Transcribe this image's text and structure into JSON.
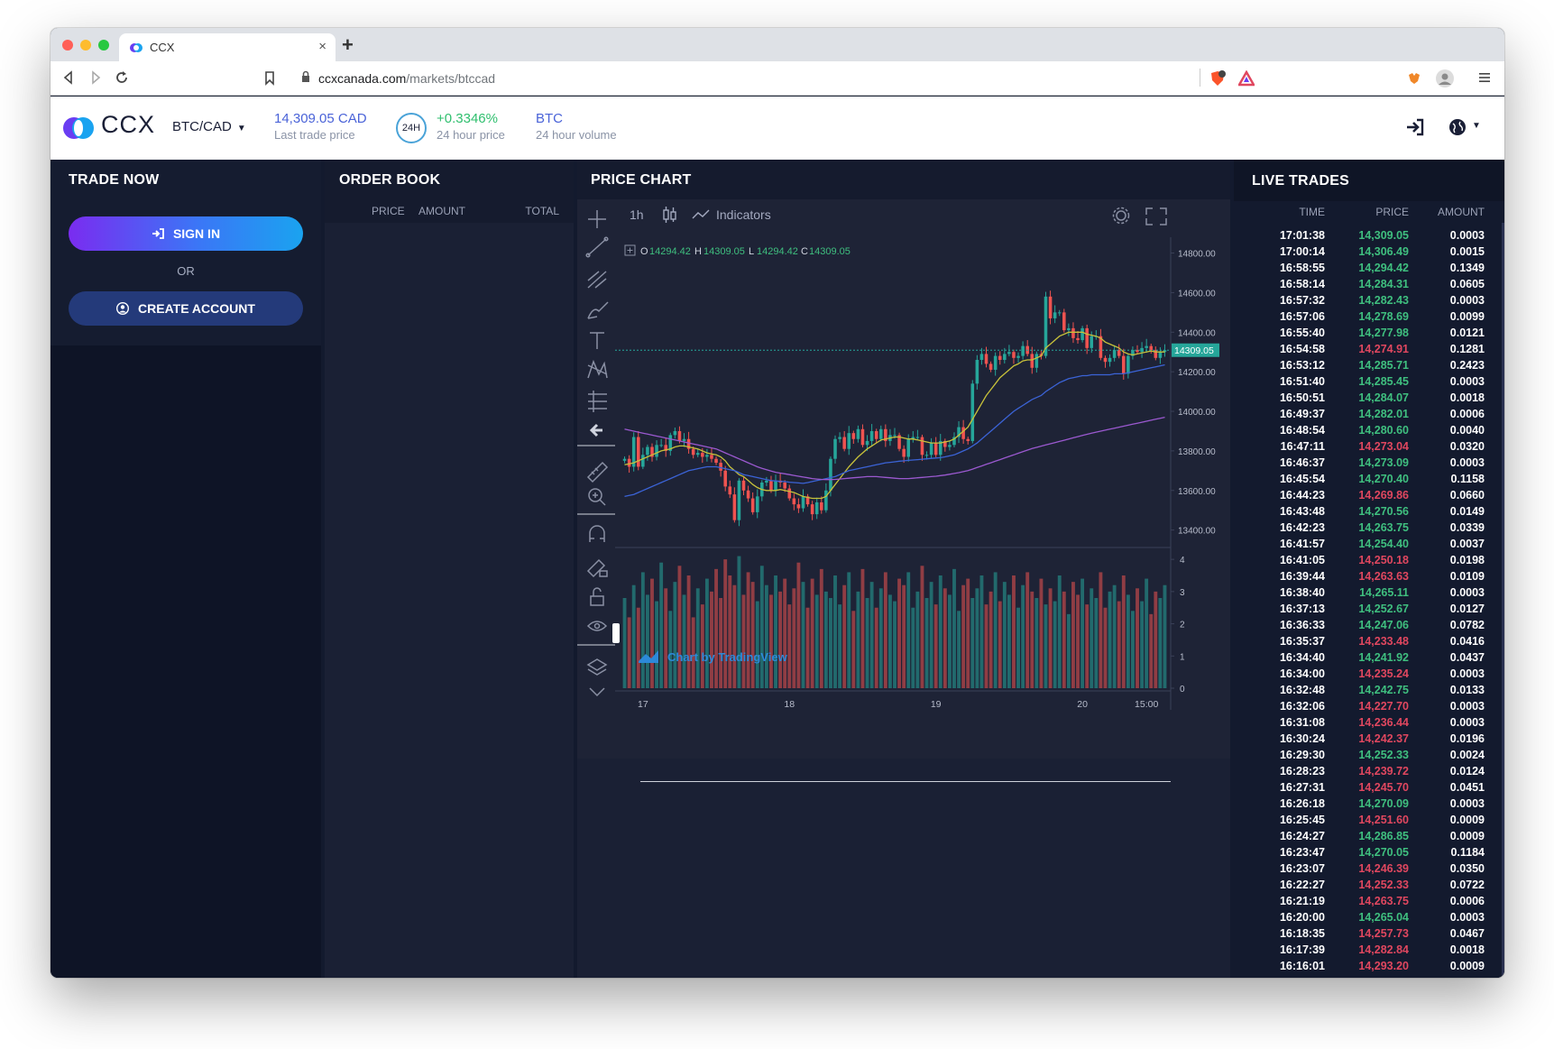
{
  "browser": {
    "tab_title": "CCX",
    "new_tab": "+",
    "tab_close": "×",
    "url_host": "ccxcanada.com",
    "url_path": "/markets/btccad"
  },
  "header": {
    "logo_text": "CCX",
    "pair": "BTC/CAD",
    "last_price": "14,309.05 CAD",
    "last_price_label": "Last trade price",
    "badge": "24H",
    "change": "+0.3346%",
    "change_label": "24 hour price",
    "volume": "BTC",
    "volume_label": "24 hour volume"
  },
  "trade_now": {
    "title": "TRADE NOW",
    "sign_in": "SIGN IN",
    "or": "OR",
    "create_account": "CREATE ACCOUNT"
  },
  "order_book": {
    "title": "ORDER BOOK",
    "columns": [
      "PRICE",
      "AMOUNT",
      "TOTAL"
    ]
  },
  "price_chart": {
    "title": "PRICE CHART",
    "interval": "1h",
    "indicators": "Indicators",
    "legend": {
      "o_label": "O",
      "o": "14294.42",
      "h_label": "H",
      "h": "14309.05",
      "l_label": "L",
      "l": "14294.42",
      "c_label": "C",
      "c": "14309.05"
    },
    "watermark": "Chart by TradingView",
    "last_price_tag": "14309.05",
    "colors": {
      "up": "#26a69a",
      "down": "#ef5350",
      "ma_fast": "#c8c23a",
      "ma_mid": "#3b63d6",
      "ma_slow": "#9b59d0"
    }
  },
  "chart_data": {
    "type": "candlestick",
    "x_ticks": [
      "17",
      "18",
      "19",
      "20",
      "15:00"
    ],
    "y_ticks": [
      "14800.00",
      "14600.00",
      "14400.00",
      "14200.00",
      "14000.00",
      "13800.00",
      "13600.00",
      "13400.00"
    ],
    "ylim": [
      13330,
      14880
    ],
    "volume_ticks": [
      "4",
      "3",
      "2",
      "1",
      "0"
    ],
    "volume_ylim": [
      0,
      4.2
    ],
    "last_price": 14309.05,
    "close": [
      13760,
      13720,
      13870,
      13720,
      13780,
      13820,
      13770,
      13830,
      13830,
      13800,
      13880,
      13900,
      13850,
      13860,
      13810,
      13780,
      13790,
      13770,
      13780,
      13760,
      13740,
      13700,
      13620,
      13580,
      13450,
      13650,
      13600,
      13560,
      13490,
      13570,
      13640,
      13650,
      13600,
      13650,
      13640,
      13610,
      13560,
      13530,
      13510,
      13570,
      13530,
      13480,
      13540,
      13500,
      13600,
      13760,
      13860,
      13870,
      13810,
      13890,
      13860,
      13910,
      13830,
      13850,
      13900,
      13860,
      13910,
      13850,
      13880,
      13880,
      13810,
      13770,
      13860,
      13870,
      13870,
      13780,
      13780,
      13840,
      13780,
      13850,
      13820,
      13830,
      13870,
      13920,
      13860,
      13850,
      14140,
      14260,
      14290,
      14240,
      14210,
      14280,
      14260,
      14290,
      14300,
      14270,
      14280,
      14330,
      14290,
      14220,
      14290,
      14280,
      14580,
      14470,
      14500,
      14500,
      14410,
      14420,
      14370,
      14360,
      14420,
      14320,
      14380,
      14380,
      14270,
      14250,
      14270,
      14310,
      14280,
      14190,
      14280,
      14310,
      14300,
      14320,
      14330,
      14310,
      14270,
      14300,
      14309.05
    ],
    "volume": [
      2.8,
      2.2,
      3.2,
      2.5,
      3.6,
      2.9,
      3.4,
      2.7,
      3.9,
      3.1,
      2.4,
      3.3,
      3.8,
      2.9,
      3.5,
      2.2,
      3.1,
      2.6,
      3.4,
      3.0,
      3.7,
      2.8,
      4.0,
      3.5,
      3.2,
      4.1,
      2.9,
      3.6,
      3.3,
      2.7,
      3.8,
      3.2,
      2.9,
      3.5,
      3.0,
      3.4,
      2.6,
      3.1,
      3.9,
      3.3,
      2.5,
      3.4,
      2.9,
      3.7,
      3.0,
      2.8,
      3.5,
      2.6,
      3.2,
      3.6,
      2.4,
      3.0,
      3.7,
      2.8,
      3.3,
      2.5,
      3.1,
      3.6,
      2.9,
      2.7,
      3.4,
      3.2,
      3.6,
      2.5,
      3.0,
      3.8,
      2.8,
      3.3,
      2.6,
      3.5,
      3.1,
      2.9,
      3.7,
      2.4,
      3.2,
      3.4,
      2.8,
      3.1,
      3.5,
      2.6,
      3.0,
      3.6,
      2.7,
      3.3,
      2.9,
      3.5,
      2.5,
      3.2,
      3.6,
      3.0,
      2.8,
      3.4,
      2.6,
      3.1,
      2.7,
      3.5,
      3.0,
      2.3,
      3.3,
      2.9,
      3.4,
      2.6,
      3.1,
      2.8,
      3.6,
      2.5,
      3.0,
      3.2,
      2.7,
      3.5,
      2.9,
      2.4,
      3.1,
      2.7,
      3.4,
      2.3,
      3.0,
      2.8,
      3.2
    ],
    "series": [
      {
        "values": [
          13730,
          13735,
          13740,
          13750,
          13760,
          13770,
          13780,
          13790,
          13800,
          13805,
          13810,
          13820,
          13825,
          13825,
          13820,
          13815,
          13810,
          13800,
          13790,
          13785,
          13780,
          13770,
          13750,
          13720,
          13700,
          13680,
          13670,
          13650,
          13630,
          13615,
          13605,
          13600,
          13600,
          13600,
          13605,
          13600,
          13595,
          13590,
          13580,
          13570,
          13565,
          13560,
          13560,
          13560,
          13570,
          13600,
          13630,
          13660,
          13690,
          13720,
          13745,
          13770,
          13790,
          13810,
          13825,
          13840,
          13855,
          13860,
          13865,
          13870,
          13870,
          13865,
          13860,
          13860,
          13855,
          13850,
          13845,
          13840,
          13840,
          13840,
          13845,
          13850,
          13860,
          13880,
          13900,
          13920,
          13960,
          14000,
          14040,
          14080,
          14110,
          14140,
          14170,
          14190,
          14210,
          14230,
          14240,
          14255,
          14260,
          14260,
          14270,
          14280,
          14320,
          14340,
          14360,
          14380,
          14390,
          14400,
          14400,
          14400,
          14400,
          14390,
          14385,
          14380,
          14370,
          14350,
          14340,
          14330,
          14320,
          14300,
          14290,
          14285,
          14290,
          14295,
          14300,
          14305,
          14300,
          14300,
          14300
        ]
      },
      {
        "values": [
          13570,
          13575,
          13580,
          13590,
          13600,
          13610,
          13620,
          13630,
          13640,
          13650,
          13660,
          13670,
          13680,
          13690,
          13700,
          13705,
          13710,
          13715,
          13720,
          13720,
          13720,
          13715,
          13710,
          13705,
          13700,
          13690,
          13680,
          13675,
          13670,
          13665,
          13660,
          13655,
          13650,
          13648,
          13646,
          13645,
          13642,
          13640,
          13638,
          13636,
          13640,
          13645,
          13650,
          13655,
          13660,
          13665,
          13670,
          13680,
          13690,
          13700,
          13705,
          13710,
          13715,
          13720,
          13725,
          13730,
          13735,
          13740,
          13742,
          13745,
          13748,
          13750,
          13752,
          13754,
          13756,
          13758,
          13760,
          13762,
          13764,
          13766,
          13770,
          13775,
          13780,
          13790,
          13800,
          13810,
          13825,
          13840,
          13860,
          13880,
          13900,
          13920,
          13940,
          13960,
          13980,
          14000,
          14015,
          14030,
          14045,
          14060,
          14070,
          14080,
          14100,
          14115,
          14130,
          14145,
          14155,
          14165,
          14170,
          14175,
          14180,
          14180,
          14185,
          14185,
          14185,
          14185,
          14185,
          14190,
          14190,
          14190,
          14195,
          14200,
          14205,
          14210,
          14215,
          14220,
          14225,
          14230,
          14235
        ]
      },
      {
        "values": [
          13910,
          13905,
          13900,
          13895,
          13890,
          13885,
          13880,
          13875,
          13870,
          13865,
          13860,
          13855,
          13850,
          13845,
          13840,
          13835,
          13830,
          13825,
          13820,
          13815,
          13810,
          13800,
          13790,
          13780,
          13770,
          13760,
          13750,
          13740,
          13730,
          13720,
          13712,
          13705,
          13698,
          13692,
          13688,
          13684,
          13680,
          13676,
          13672,
          13668,
          13664,
          13660,
          13658,
          13656,
          13655,
          13655,
          13656,
          13658,
          13660,
          13662,
          13664,
          13666,
          13668,
          13670,
          13670,
          13670,
          13668,
          13666,
          13664,
          13662,
          13660,
          13660,
          13660,
          13662,
          13664,
          13666,
          13668,
          13670,
          13672,
          13675,
          13678,
          13682,
          13686,
          13690,
          13695,
          13700,
          13708,
          13716,
          13724,
          13732,
          13740,
          13748,
          13756,
          13764,
          13772,
          13780,
          13788,
          13796,
          13804,
          13812,
          13818,
          13824,
          13830,
          13836,
          13842,
          13848,
          13854,
          13860,
          13866,
          13872,
          13878,
          13884,
          13890,
          13895,
          13900,
          13905,
          13910,
          13915,
          13920,
          13925,
          13930,
          13935,
          13940,
          13945,
          13950,
          13955,
          13960,
          13965,
          13970
        ]
      }
    ]
  },
  "live_trades": {
    "title": "LIVE TRADES",
    "columns": [
      "TIME",
      "PRICE",
      "AMOUNT"
    ],
    "rows": [
      {
        "time": "17:01:38",
        "price": "14,309.05",
        "amount": "0.0003",
        "side": "up"
      },
      {
        "time": "17:00:14",
        "price": "14,306.49",
        "amount": "0.0015",
        "side": "up"
      },
      {
        "time": "16:58:55",
        "price": "14,294.42",
        "amount": "0.1349",
        "side": "up"
      },
      {
        "time": "16:58:14",
        "price": "14,284.31",
        "amount": "0.0605",
        "side": "up"
      },
      {
        "time": "16:57:32",
        "price": "14,282.43",
        "amount": "0.0003",
        "side": "up"
      },
      {
        "time": "16:57:06",
        "price": "14,278.69",
        "amount": "0.0099",
        "side": "up"
      },
      {
        "time": "16:55:40",
        "price": "14,277.98",
        "amount": "0.0121",
        "side": "up"
      },
      {
        "time": "16:54:58",
        "price": "14,274.91",
        "amount": "0.1281",
        "side": "down"
      },
      {
        "time": "16:53:12",
        "price": "14,285.71",
        "amount": "0.2423",
        "side": "up"
      },
      {
        "time": "16:51:40",
        "price": "14,285.45",
        "amount": "0.0003",
        "side": "up"
      },
      {
        "time": "16:50:51",
        "price": "14,284.07",
        "amount": "0.0018",
        "side": "up"
      },
      {
        "time": "16:49:37",
        "price": "14,282.01",
        "amount": "0.0006",
        "side": "up"
      },
      {
        "time": "16:48:54",
        "price": "14,280.60",
        "amount": "0.0040",
        "side": "up"
      },
      {
        "time": "16:47:11",
        "price": "14,273.04",
        "amount": "0.0320",
        "side": "down"
      },
      {
        "time": "16:46:37",
        "price": "14,273.09",
        "amount": "0.0003",
        "side": "up"
      },
      {
        "time": "16:45:54",
        "price": "14,270.40",
        "amount": "0.1158",
        "side": "up"
      },
      {
        "time": "16:44:23",
        "price": "14,269.86",
        "amount": "0.0660",
        "side": "down"
      },
      {
        "time": "16:43:48",
        "price": "14,270.56",
        "amount": "0.0149",
        "side": "up"
      },
      {
        "time": "16:42:23",
        "price": "14,263.75",
        "amount": "0.0339",
        "side": "up"
      },
      {
        "time": "16:41:57",
        "price": "14,254.40",
        "amount": "0.0037",
        "side": "up"
      },
      {
        "time": "16:41:05",
        "price": "14,250.18",
        "amount": "0.0198",
        "side": "down"
      },
      {
        "time": "16:39:44",
        "price": "14,263.63",
        "amount": "0.0109",
        "side": "down"
      },
      {
        "time": "16:38:40",
        "price": "14,265.11",
        "amount": "0.0003",
        "side": "up"
      },
      {
        "time": "16:37:13",
        "price": "14,252.67",
        "amount": "0.0127",
        "side": "up"
      },
      {
        "time": "16:36:33",
        "price": "14,247.06",
        "amount": "0.0782",
        "side": "up"
      },
      {
        "time": "16:35:37",
        "price": "14,233.48",
        "amount": "0.0416",
        "side": "down"
      },
      {
        "time": "16:34:40",
        "price": "14,241.92",
        "amount": "0.0437",
        "side": "up"
      },
      {
        "time": "16:34:00",
        "price": "14,235.24",
        "amount": "0.0003",
        "side": "down"
      },
      {
        "time": "16:32:48",
        "price": "14,242.75",
        "amount": "0.0133",
        "side": "up"
      },
      {
        "time": "16:32:06",
        "price": "14,227.70",
        "amount": "0.0003",
        "side": "down"
      },
      {
        "time": "16:31:08",
        "price": "14,236.44",
        "amount": "0.0003",
        "side": "down"
      },
      {
        "time": "16:30:24",
        "price": "14,242.37",
        "amount": "0.0196",
        "side": "down"
      },
      {
        "time": "16:29:30",
        "price": "14,252.33",
        "amount": "0.0024",
        "side": "up"
      },
      {
        "time": "16:28:23",
        "price": "14,239.72",
        "amount": "0.0124",
        "side": "down"
      },
      {
        "time": "16:27:31",
        "price": "14,245.70",
        "amount": "0.0451",
        "side": "down"
      },
      {
        "time": "16:26:18",
        "price": "14,270.09",
        "amount": "0.0003",
        "side": "up"
      },
      {
        "time": "16:25:45",
        "price": "14,251.60",
        "amount": "0.0009",
        "side": "down"
      },
      {
        "time": "16:24:27",
        "price": "14,286.85",
        "amount": "0.0009",
        "side": "up"
      },
      {
        "time": "16:23:47",
        "price": "14,270.05",
        "amount": "0.1184",
        "side": "up"
      },
      {
        "time": "16:23:07",
        "price": "14,246.39",
        "amount": "0.0350",
        "side": "down"
      },
      {
        "time": "16:22:27",
        "price": "14,252.33",
        "amount": "0.0722",
        "side": "down"
      },
      {
        "time": "16:21:19",
        "price": "14,263.75",
        "amount": "0.0006",
        "side": "down"
      },
      {
        "time": "16:20:00",
        "price": "14,265.04",
        "amount": "0.0003",
        "side": "up"
      },
      {
        "time": "16:18:35",
        "price": "14,257.73",
        "amount": "0.0467",
        "side": "down"
      },
      {
        "time": "16:17:39",
        "price": "14,282.84",
        "amount": "0.0018",
        "side": "down"
      },
      {
        "time": "16:16:01",
        "price": "14,293.20",
        "amount": "0.0009",
        "side": "down"
      }
    ]
  }
}
